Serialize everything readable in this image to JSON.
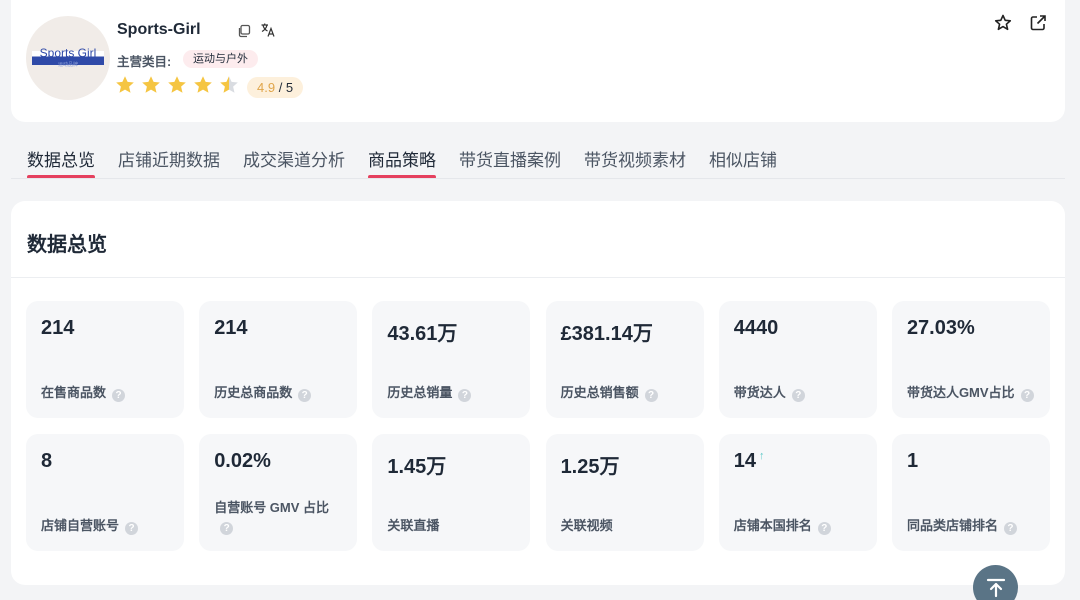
{
  "shop": {
    "logo_text": "Sports Girl",
    "logo_subtext": "运动品牌",
    "name": "Sports-Girl",
    "category_label": "主营类目:",
    "category": "运动与户外",
    "rating": 4.9,
    "rating_score": "4.9",
    "rating_max": " / 5"
  },
  "tabs": [
    {
      "label": "数据总览",
      "active": true
    },
    {
      "label": "店铺近期数据",
      "active": false
    },
    {
      "label": "成交渠道分析",
      "active": false
    },
    {
      "label": "商品策略",
      "active": true
    },
    {
      "label": "带货直播案例",
      "active": false
    },
    {
      "label": "带货视频素材",
      "active": false
    },
    {
      "label": "相似店铺",
      "active": false
    }
  ],
  "overview": {
    "title": "数据总览",
    "stats": [
      {
        "value": "214",
        "label": "在售商品数",
        "help": true
      },
      {
        "value": "214",
        "label": "历史总商品数",
        "help": true
      },
      {
        "value": "43.61万",
        "label": "历史总销量",
        "help": true
      },
      {
        "value": "£381.14万",
        "label": "历史总销售额",
        "help": true
      },
      {
        "value": "4440",
        "label": "带货达人",
        "help": true
      },
      {
        "value": "27.03%",
        "label": "带货达人GMV占比",
        "help": true
      },
      {
        "value": "8",
        "label": "店铺自营账号",
        "help": true
      },
      {
        "value": "0.02%",
        "label": "自营账号 GMV 占比",
        "help": true
      },
      {
        "value": "1.45万",
        "label": "关联直播",
        "help": false
      },
      {
        "value": "1.25万",
        "label": "关联视频",
        "help": false
      },
      {
        "value": "14",
        "label": "店铺本国排名",
        "help": true,
        "trend": "↑"
      },
      {
        "value": "1",
        "label": "同品类店铺排名",
        "help": true
      }
    ]
  },
  "colors": {
    "accent": "#e5405e",
    "star": "#f5c542",
    "star_empty": "#d9dce1",
    "trend_up": "#5ec9c8"
  },
  "icons": {
    "copy": "copy-icon",
    "translate": "translate-icon",
    "favorite": "star-outline-icon",
    "share": "external-link-icon",
    "help": "question-circle-icon",
    "back_to_top": "arrow-up-icon"
  }
}
